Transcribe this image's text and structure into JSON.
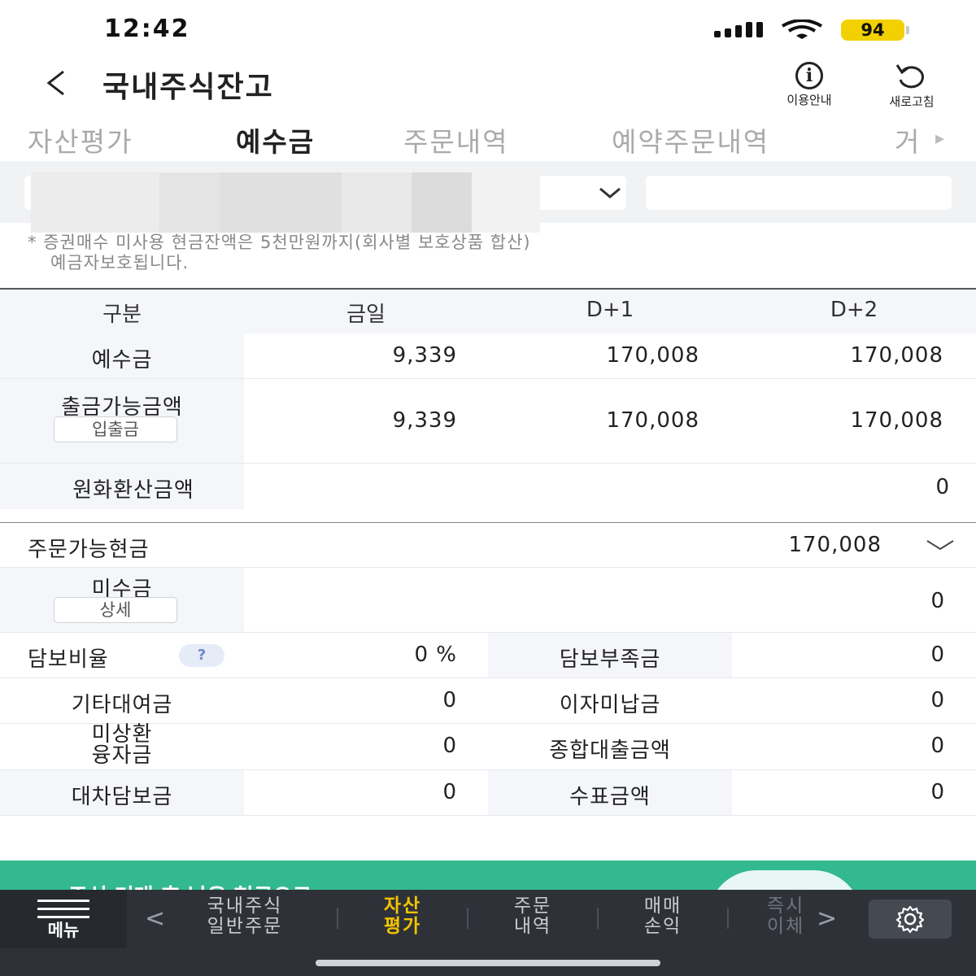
{
  "status_bar": {
    "time": "12:42",
    "battery": "94"
  },
  "header": {
    "title": "국내주식잔고",
    "info_label": "이용안내",
    "refresh_label": "새로고침"
  },
  "tabs": [
    {
      "label": "자산평가",
      "active": false
    },
    {
      "label": "예수금",
      "active": true
    },
    {
      "label": "주문내역",
      "active": false
    },
    {
      "label": "예약주문내역",
      "active": false
    },
    {
      "label": "거",
      "active": false
    }
  ],
  "notice": {
    "line1": "* 증권매수 미사용 현금잔액은 5천만원까지(회사별 보호상품 합산)",
    "line2": "예금자보호됩니다."
  },
  "balance_table": {
    "headers": [
      "구분",
      "금일",
      "D+1",
      "D+2"
    ],
    "deposit": {
      "label": "예수금",
      "today": "9,339",
      "d1": "170,008",
      "d2": "170,008"
    },
    "withdrawable": {
      "label": "출금가능금액",
      "button": "입출금",
      "today": "9,339",
      "d1": "170,008",
      "d2": "170,008"
    },
    "krw_converted": {
      "label": "원화환산금액",
      "value": "0"
    }
  },
  "order_section": {
    "orderable_cash": {
      "label": "주문가능현금",
      "value": "170,008"
    },
    "receivable": {
      "label": "미수금",
      "button": "상세",
      "value": "0"
    },
    "collateral_ratio": {
      "label": "담보비율",
      "help": "?",
      "value": "0 %"
    },
    "collateral_shortfall": {
      "label": "담보부족금",
      "value": "0"
    },
    "other_loan": {
      "label": "기타대여금",
      "value": "0"
    },
    "unpaid_interest": {
      "label": "이자미납금",
      "value": "0"
    },
    "unrepaid_loan": {
      "label_line1": "미상환",
      "label_line2": "융자금",
      "value": "0"
    },
    "total_loan": {
      "label": "종합대출금액",
      "value": "0"
    },
    "lending_collateral": {
      "label": "대차담보금",
      "value": "0"
    },
    "check_amount": {
      "label": "수표금액",
      "value": "0"
    }
  },
  "promo": {
    "text": "주식 거래 후 남은 현금으로"
  },
  "bottom_nav": {
    "menu_label": "메뉴",
    "items": [
      {
        "line1": "국내주식",
        "line2": "일반주문",
        "active": false
      },
      {
        "line1": "자산",
        "line2": "평가",
        "active": true
      },
      {
        "line1": "주문",
        "line2": "내역",
        "active": false
      },
      {
        "line1": "매매",
        "line2": "손익",
        "active": false
      },
      {
        "line1": "즉시",
        "line2": "이체",
        "active": false
      }
    ]
  },
  "colors": {
    "accent_yellow": "#f5c400",
    "battery_yellow": "#f3d000",
    "promo_green": "#33b98f",
    "nav_bg": "#2e3238",
    "label_bg": "#f4f6f9"
  }
}
